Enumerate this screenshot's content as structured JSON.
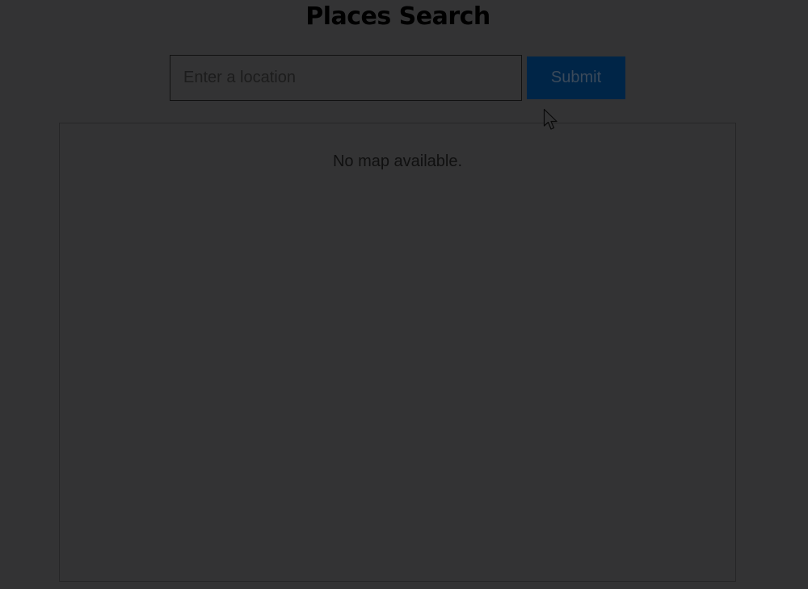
{
  "header": {
    "title": "Places Search"
  },
  "search": {
    "placeholder": "Enter a location",
    "value": "",
    "submit_label": "Submit"
  },
  "map": {
    "message": "No map available."
  },
  "colors": {
    "background": "#333334",
    "submit_bg": "#002547",
    "submit_text": "#3b4a5a"
  },
  "icons": {
    "cursor": "mouse-pointer-icon"
  }
}
